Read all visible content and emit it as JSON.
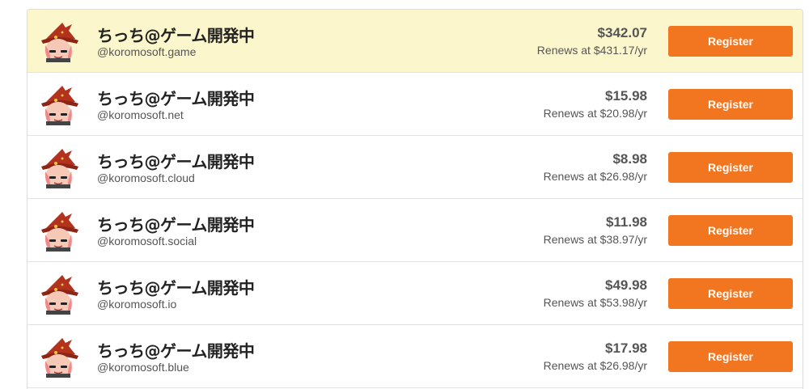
{
  "colors": {
    "highlight": "#fcf6cc",
    "button": "#f27520",
    "border": "#dcdcdc"
  },
  "avatar_icon": "witch-character-icon",
  "rows": [
    {
      "name": "ちっち@ゲーム開発中",
      "handle": "@koromosoft.game",
      "price": "$342.07",
      "renews": "Renews at $431.17/yr",
      "button": "Register",
      "highlighted": true
    },
    {
      "name": "ちっち@ゲーム開発中",
      "handle": "@koromosoft.net",
      "price": "$15.98",
      "renews": "Renews at $20.98/yr",
      "button": "Register",
      "highlighted": false
    },
    {
      "name": "ちっち@ゲーム開発中",
      "handle": "@koromosoft.cloud",
      "price": "$8.98",
      "renews": "Renews at $26.98/yr",
      "button": "Register",
      "highlighted": false
    },
    {
      "name": "ちっち@ゲーム開発中",
      "handle": "@koromosoft.social",
      "price": "$11.98",
      "renews": "Renews at $38.97/yr",
      "button": "Register",
      "highlighted": false
    },
    {
      "name": "ちっち@ゲーム開発中",
      "handle": "@koromosoft.io",
      "price": "$49.98",
      "renews": "Renews at $53.98/yr",
      "button": "Register",
      "highlighted": false
    },
    {
      "name": "ちっち@ゲーム開発中",
      "handle": "@koromosoft.blue",
      "price": "$17.98",
      "renews": "Renews at $26.98/yr",
      "button": "Register",
      "highlighted": false
    }
  ]
}
